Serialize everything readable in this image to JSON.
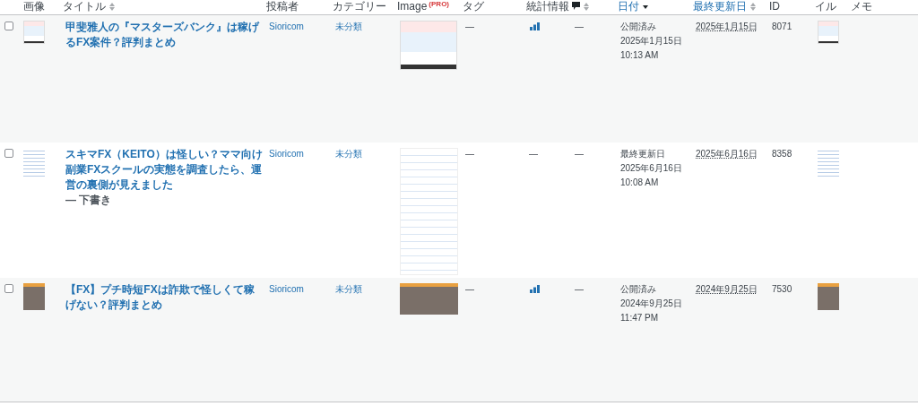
{
  "columns": [
    {
      "label": "画像",
      "kind": "plain",
      "link": false
    },
    {
      "label": "タイトル",
      "kind": "sortable",
      "link": false
    },
    {
      "label": "投稿者",
      "kind": "plain",
      "link": false
    },
    {
      "label": "カテゴリー",
      "kind": "plain",
      "link": false
    },
    {
      "label": "Image",
      "badge": "(PRO)",
      "kind": "plain",
      "link": false
    },
    {
      "label": "タグ",
      "kind": "plain",
      "link": false
    },
    {
      "label": "統計情報",
      "kind": "plain",
      "link": false
    },
    {
      "kind": "comments",
      "link": false
    },
    {
      "label": "日付",
      "kind": "sorted",
      "link": true
    },
    {
      "label": "最終更新日",
      "kind": "sortable",
      "link": true
    },
    {
      "label": "ID",
      "kind": "plain",
      "link": false
    },
    {
      "label": "イル",
      "kind": "plain",
      "link": false
    },
    {
      "label": "メモ",
      "kind": "plain",
      "link": false
    }
  ],
  "rows": [
    {
      "checked": false,
      "kind": "banner",
      "title": "甲斐雅人の『マスターズバンク』は稼げるFX案件？評判まとめ",
      "author": "Sioricom",
      "category": "未分類",
      "tag": "—",
      "stats_icon": true,
      "comments": "—",
      "status": "公開済み",
      "date": "2025年1月15日",
      "time": "10:13 AM",
      "modified": "2025年1月15日",
      "id": "8071"
    },
    {
      "checked": false,
      "kind": "list",
      "title": "スキマFX（KEITO）は怪しい？ママ向け副業FXスクールの実態を調査したら、運営の裏側が見えました",
      "post_state": "— 下書き",
      "author": "Sioricom",
      "category": "未分類",
      "tag": "—",
      "stats_icon": false,
      "stats": "—",
      "comments": "—",
      "status": "最終更新日",
      "date": "2025年6月16日",
      "time": "10:08 AM",
      "modified": "2025年6月16日",
      "id": "8358"
    },
    {
      "checked": false,
      "kind": "group",
      "title": "【FX】プチ時短FXは詐欺で怪しくて稼げない？評判まとめ",
      "author": "Sioricom",
      "category": "未分類",
      "tag": "—",
      "stats_icon": true,
      "comments": "—",
      "status": "公開済み",
      "date": "2024年9月25日",
      "time": "11:47 PM",
      "modified": "2024年9月25日",
      "id": "7530"
    }
  ]
}
